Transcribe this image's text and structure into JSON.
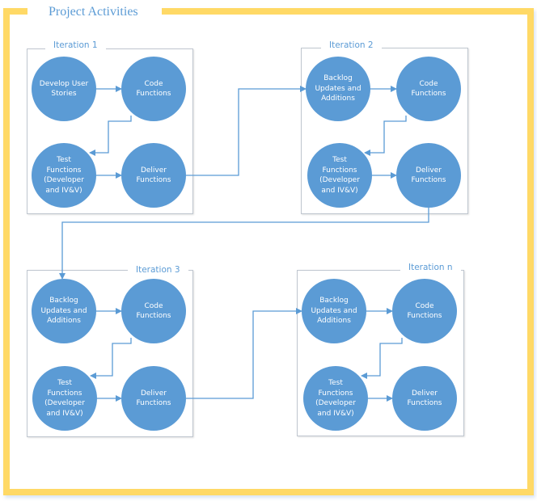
{
  "title": "Project Activities",
  "colors": {
    "frame": "#FFD966",
    "node": "#5B9BD5",
    "connector": "#5B9BD5",
    "label": "#5B9BD5",
    "box_border": "#BFC6CF"
  },
  "iterations": [
    {
      "label": "Iteration 1",
      "nodes": {
        "start": "Develop User\nStories",
        "code": "Code\nFunctions",
        "test": "Test\nFunctions\n(Developer\nand IV&V)",
        "deliver": "Deliver\nFunctions"
      }
    },
    {
      "label": "Iteration 2",
      "nodes": {
        "start": "Backlog\nUpdates and\nAdditions",
        "code": "Code\nFunctions",
        "test": "Test\nFunctions\n(Developer\nand IV&V)",
        "deliver": "Deliver\nFunctions"
      }
    },
    {
      "label": "Iteration 3",
      "nodes": {
        "start": "Backlog\nUpdates and\nAdditions",
        "code": "Code\nFunctions",
        "test": "Test\nFunctions\n(Developer\nand IV&V)",
        "deliver": "Deliver\nFunctions"
      }
    },
    {
      "label": "Iteration n",
      "nodes": {
        "start": "Backlog\nUpdates and\nAdditions",
        "code": "Code\nFunctions",
        "test": "Test\nFunctions\n(Developer\nand IV&V)",
        "deliver": "Deliver\nFunctions"
      }
    }
  ],
  "flow": [
    "Develop User Stories -> Code Functions -> Test Functions -> Deliver Functions",
    "Iteration 1 Deliver -> Iteration 2 Backlog",
    "Iteration 2 Deliver -> Iteration 3 Backlog",
    "Iteration 3 Deliver -> Iteration n Backlog"
  ]
}
